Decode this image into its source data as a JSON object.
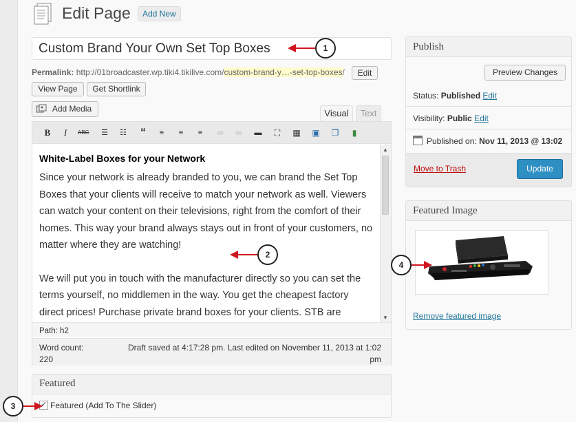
{
  "header": {
    "title": "Edit Page",
    "add_new": "Add New"
  },
  "post": {
    "title": "Custom Brand Your Own Set Top Boxes"
  },
  "permalink": {
    "label": "Permalink:",
    "base": "http://01broadcaster.wp.tiki4.tikilive.com/",
    "slug": "custom-brand-y…-set-top-boxes",
    "tail": "/",
    "edit": "Edit"
  },
  "actions": {
    "view_page": "View Page",
    "get_shortlink": "Get Shortlink",
    "add_media": "Add Media"
  },
  "editor": {
    "tabs": [
      "Visual",
      "Text"
    ],
    "toolbar_icons": [
      "bold-icon",
      "italic-icon",
      "strikethrough-icon",
      "bullet-list-icon",
      "numbered-list-icon",
      "blockquote-icon",
      "align-left-icon",
      "align-center-icon",
      "align-right-icon",
      "insert-link-icon",
      "unlink-icon",
      "more-tag-icon",
      "fullscreen-icon",
      "kitchen-sink-icon",
      "insert-image-icon",
      "insert-gallery-icon",
      "insert-video-icon"
    ],
    "heading": "White-Label Boxes for your Network",
    "paragraphs": [
      "Since your network is already branded to you, we can brand the Set Top Boxes that your clients will receive to match your network as well. Viewers can watch your content on their televisions, right from the comfort of their homes. This way your brand always stays out in front of your customers, no matter where they are watching!",
      "We will put you in touch with the manufacturer directly so you can set the terms yourself, no middlemen in the way. You get the cheapest factory direct prices! Purchase private brand boxes for your clients. STB are"
    ],
    "path": "Path: h2",
    "word_count_label": "Word count:",
    "word_count": "220",
    "status_line1": "Draft saved at 4:17:28 pm. Last edited on November 11, 2013 at 1:02",
    "status_line2": "pm"
  },
  "featured": {
    "title": "Featured",
    "checkbox_label": "Featured (Add To The Slider)",
    "checked": true
  },
  "publish": {
    "title": "Publish",
    "preview": "Preview Changes",
    "status_label": "Status:",
    "status_value": "Published",
    "visibility_label": "Visibility:",
    "visibility_value": "Public",
    "edit": "Edit",
    "published_on_label": "Published on:",
    "published_on_value": "Nov 11, 2013 @ 13:02",
    "trash": "Move to Trash",
    "update": "Update"
  },
  "featured_image": {
    "title": "Featured Image",
    "remove": "Remove featured image"
  },
  "callouts": [
    "1",
    "2",
    "3",
    "4"
  ]
}
